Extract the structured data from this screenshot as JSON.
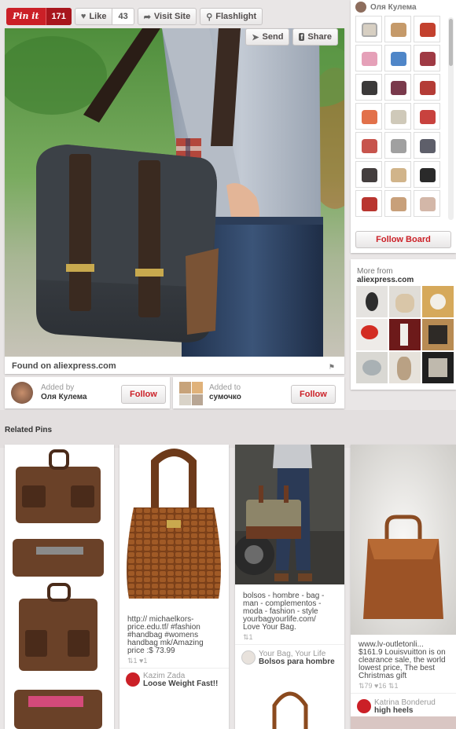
{
  "actions": {
    "pinit_label": "Pin it",
    "pinit_count": "171",
    "like_label": "Like",
    "like_count": "43",
    "visit_label": "Visit Site",
    "flashlight_label": "Flashlight",
    "send_label": "Send",
    "share_label": "Share"
  },
  "pin": {
    "found_on": "Found on aliexpress.com"
  },
  "added_by": {
    "label": "Added by",
    "name": "Оля Кулема",
    "follow": "Follow"
  },
  "added_to": {
    "label": "Added to",
    "board": "сумочко",
    "follow": "Follow"
  },
  "sidebar": {
    "owner_name": "Оля Кулема",
    "follow_board": "Follow Board",
    "more_from": "More from",
    "more_source": "aliexpress.com"
  },
  "related": {
    "title": "Related Pins",
    "pins": [
      {
        "desc": [
          "http:// michaelkors-",
          "price.edu.tf/ #fashion",
          "#handbag #womens",
          "handbag mk/Amazing",
          "price :$ 73.99"
        ],
        "stats": "⇅1  ♥1",
        "pinner": "Kazim Zada",
        "board": "Loose Weight Fast!!"
      },
      {
        "desc": [
          "bolsos - hombre - bag -",
          "man - complementos -",
          "moda - fashion - style",
          "yourbagyourlife.com/",
          "Love Your Bag."
        ],
        "stats": "⇅1",
        "pinner": "Your Bag, Your Life",
        "board": "Bolsos para hombre"
      },
      {
        "desc": [
          "www.lv-outletonli...",
          "$161.9 Louisvuitton is on",
          "clearance sale, the world",
          "lowest price, The best",
          "Christmas gift"
        ],
        "stats": "⇅79  ♥16  ⇅1",
        "pinner": "Katrina Bonderud",
        "board": "high heels"
      }
    ]
  },
  "colors": {
    "brand_red": "#cb2027"
  }
}
